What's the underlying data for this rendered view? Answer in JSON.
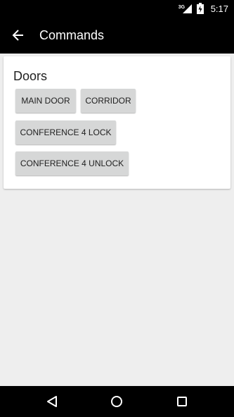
{
  "status_bar": {
    "network": "3G",
    "time": "5:17"
  },
  "app_bar": {
    "title": "Commands",
    "back_icon": "arrow-back-icon"
  },
  "card": {
    "title": "Doors",
    "buttons": [
      {
        "label": "MAIN DOOR"
      },
      {
        "label": "CORRIDOR"
      },
      {
        "label": "CONFERENCE 4 LOCK"
      },
      {
        "label": "CONFERENCE 4 UNLOCK"
      }
    ]
  },
  "nav_bar": {
    "back_icon": "nav-back-icon",
    "home_icon": "nav-home-icon",
    "recents_icon": "nav-recents-icon"
  },
  "colors": {
    "bar_background": "#000000",
    "screen_background": "#eeeeee",
    "card_background": "#ffffff",
    "button_background": "#d6d7d7"
  }
}
